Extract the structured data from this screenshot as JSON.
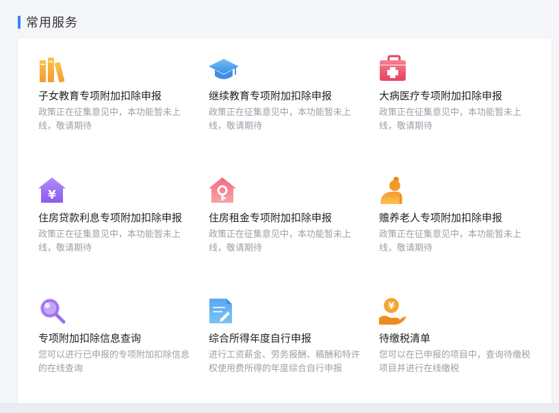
{
  "section": {
    "title": "常用服务"
  },
  "services": [
    {
      "icon": "books-icon",
      "title": "子女教育专项附加扣除申报",
      "desc": "政策正在征集意见中，本功能暂未上线，敬请期待"
    },
    {
      "icon": "graduation-cap-icon",
      "title": "继续教育专项附加扣除申报",
      "desc": "政策正在征集意见中，本功能暂未上线，敬请期待"
    },
    {
      "icon": "medical-kit-icon",
      "title": "大病医疗专项附加扣除申报",
      "desc": "政策正在征集意见中，本功能暂未上线，敬请期待"
    },
    {
      "icon": "house-yuan-icon",
      "title": "住房贷款利息专项附加扣除申报",
      "desc": "政策正在征集意见中，本功能暂未上线，敬请期待"
    },
    {
      "icon": "house-key-icon",
      "title": "住房租金专项附加扣除申报",
      "desc": "政策正在征集意见中，本功能暂未上线，敬请期待"
    },
    {
      "icon": "elderly-person-icon",
      "title": "赡养老人专项附加扣除申报",
      "desc": "政策正在征集意见中，本功能暂未上线，敬请期待"
    },
    {
      "icon": "magnifier-icon",
      "title": "专项附加扣除信息查询",
      "desc": "您可以进行已申报的专项附加扣除信息的在线查询"
    },
    {
      "icon": "document-edit-icon",
      "title": "综合所得年度自行申报",
      "desc": "进行工资薪金、劳务报酬、稿酬和特许权使用费所得的年度综合自行申报"
    },
    {
      "icon": "hand-coin-icon",
      "title": "待缴税清单",
      "desc": "您可以在已申报的项目中，查询待缴税项目并进行在线缴税"
    }
  ],
  "colors": {
    "accent": "#3b82f6",
    "orange": "#f7a42b",
    "blue": "#4a9be8",
    "red": "#ef4f6a",
    "purple": "#9b6ff0"
  }
}
